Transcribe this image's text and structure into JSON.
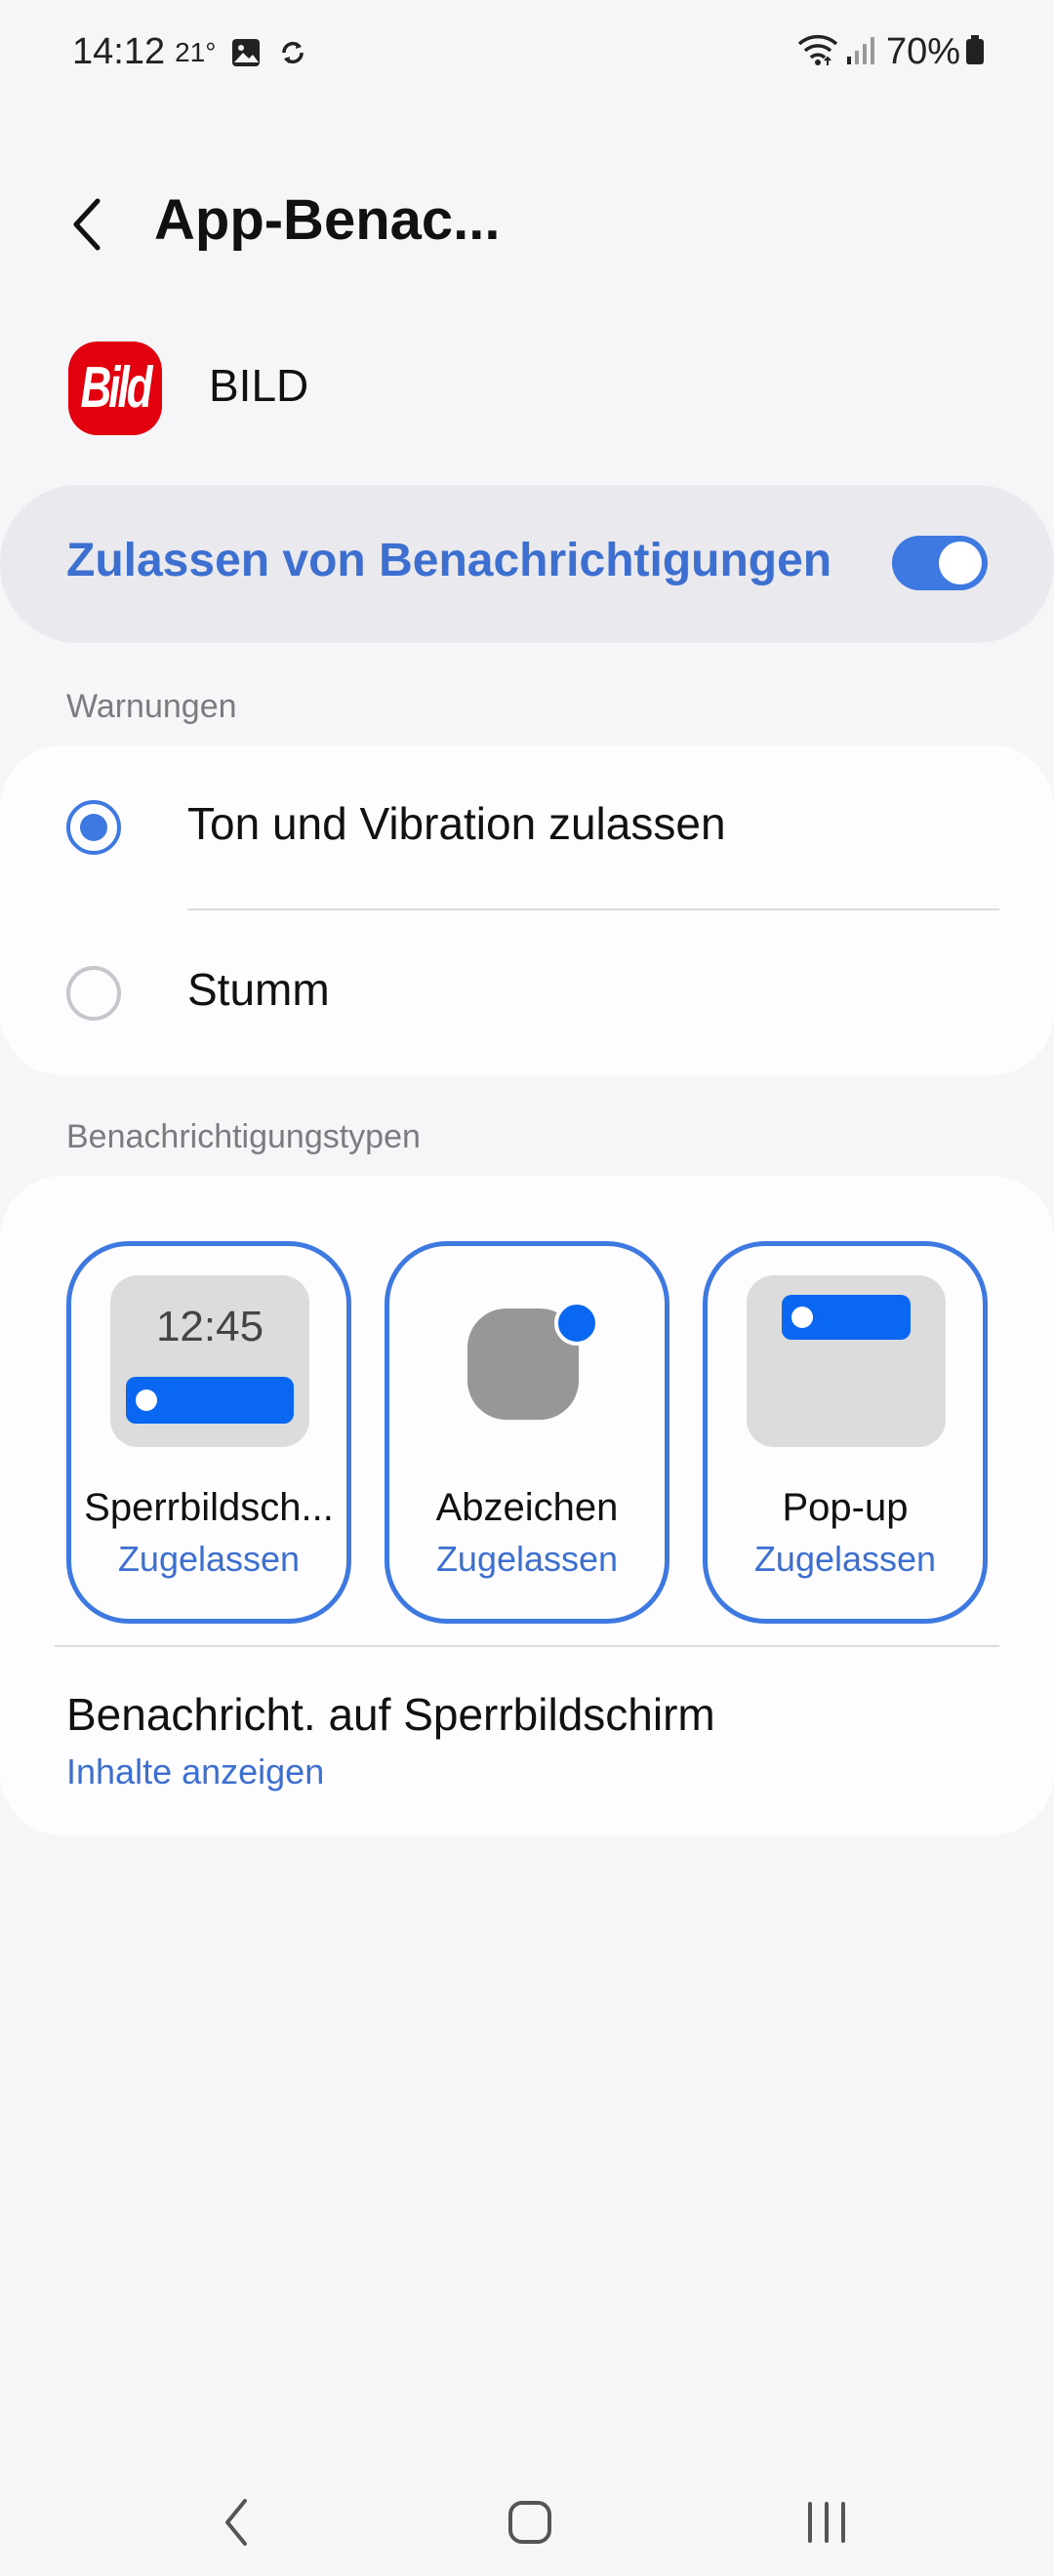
{
  "status_bar": {
    "time": "14:12",
    "temperature": "21°",
    "battery": "70%",
    "icons": [
      "gallery-icon",
      "sync-icon",
      "wifi-icon",
      "signal-icon",
      "battery-icon"
    ]
  },
  "header": {
    "title": "App-Benac..."
  },
  "app": {
    "name": "BILD",
    "icon_text": "Bild",
    "icon_color": "#e2000f"
  },
  "master_toggle": {
    "label": "Zulassen von Benachrichtigungen",
    "enabled": true,
    "accent": "#3d79e0"
  },
  "alerts_section": {
    "header": "Warnungen",
    "options": [
      {
        "label": "Ton und Vibration zulassen",
        "selected": true
      },
      {
        "label": "Stumm",
        "selected": false
      }
    ]
  },
  "types_section": {
    "header": "Benachrichtigungstypen",
    "tiles": [
      {
        "name": "Sperrbildsch...",
        "status": "Zugelassen",
        "preview_time": "12:45"
      },
      {
        "name": "Abzeichen",
        "status": "Zugelassen"
      },
      {
        "name": "Pop-up",
        "status": "Zugelassen"
      }
    ],
    "lock_screen": {
      "title": "Benachricht. auf Sperrbildschirm",
      "value": "Inhalte anzeigen"
    }
  },
  "nav_bar": {
    "buttons": [
      "back-icon",
      "home-icon",
      "recents-icon"
    ]
  }
}
